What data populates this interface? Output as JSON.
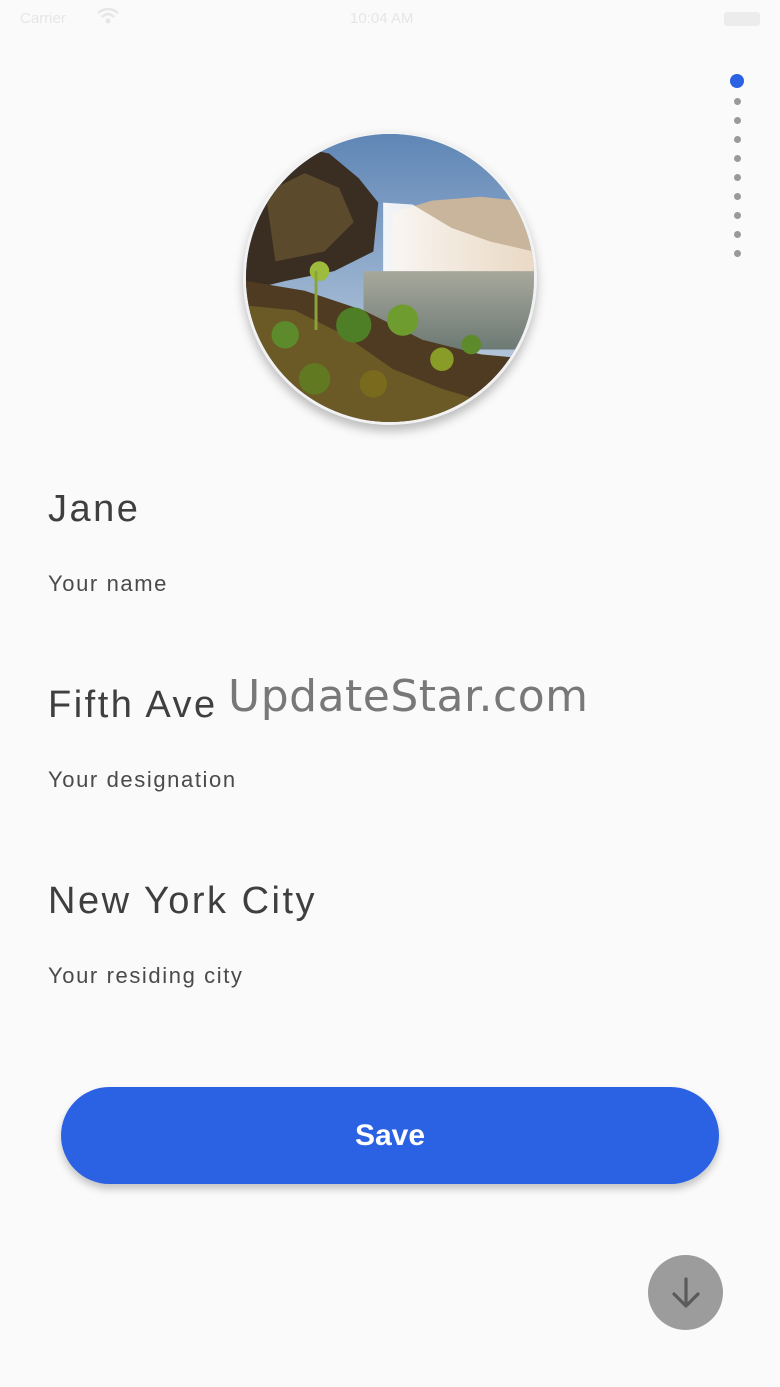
{
  "status_bar": {
    "carrier": "Carrier",
    "time": "10:04 AM"
  },
  "page_indicator": {
    "active_index": 0,
    "count": 10,
    "active_color": "#2b62e3"
  },
  "avatar": {
    "icon": "waterfall-photo"
  },
  "form": {
    "name": {
      "value": "Jane",
      "label": "Your name"
    },
    "designation": {
      "value": "Fifth Ave",
      "label": "Your designation"
    },
    "city": {
      "value": "New York City",
      "label": "Your residing city"
    }
  },
  "watermark": "UpdateStar.com",
  "save_button": {
    "label": "Save",
    "color": "#2b62e3"
  },
  "scroll_button": {
    "icon": "arrow-down-icon"
  }
}
